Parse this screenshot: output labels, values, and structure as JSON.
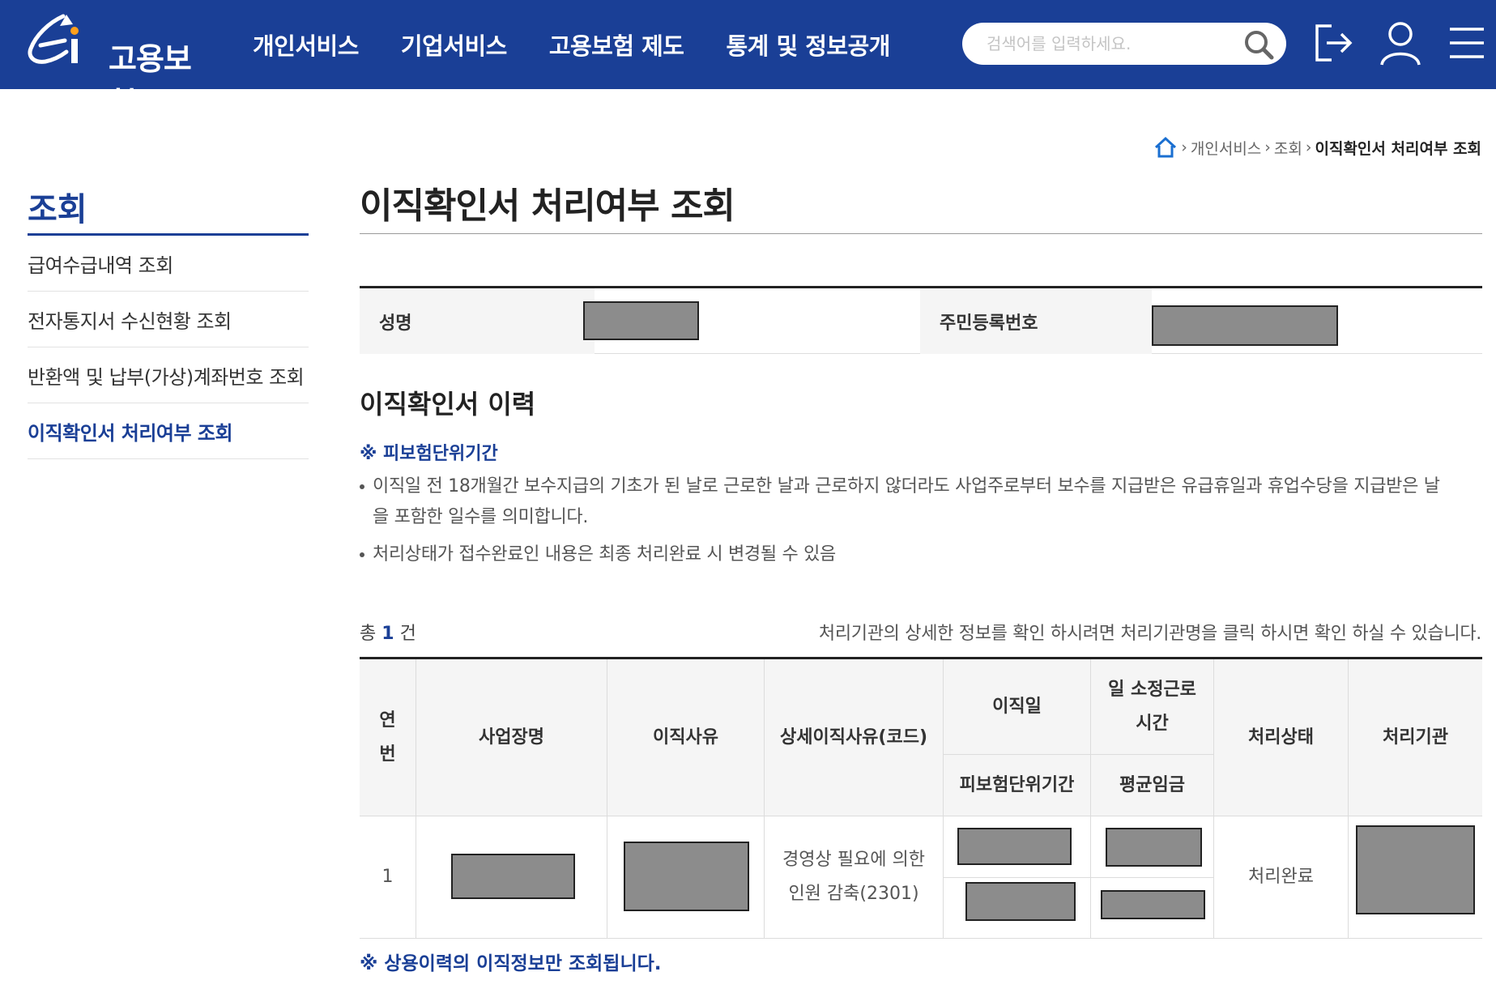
{
  "header": {
    "logo_text": "고용보험",
    "nav": [
      "개인서비스",
      "기업서비스",
      "고용보험 제도",
      "통계 및 정보공개"
    ],
    "search_placeholder": "검색어를 입력하세요.",
    "brand_color": "#1a3f96"
  },
  "breadcrumb": {
    "items": [
      "개인서비스",
      "조회"
    ],
    "current": "이직확인서 처리여부 조회"
  },
  "sidebar": {
    "title": "조회",
    "items": [
      {
        "label": "급여수급내역 조회",
        "active": false
      },
      {
        "label": "전자통지서 수신현황 조회",
        "active": false
      },
      {
        "label": "반환액 및 납부(가상)계좌번호 조회",
        "active": false
      },
      {
        "label": "이직확인서 처리여부 조회",
        "active": true
      }
    ]
  },
  "main": {
    "title": "이직확인서 처리여부 조회",
    "info": {
      "name_label": "성명",
      "rrn_label": "주민등록번호"
    },
    "history_title": "이직확인서 이력",
    "note_title": "※ 피보험단위기간",
    "bullets": [
      "이직일 전 18개월간 보수지급의 기초가 된 날로 근로한 날과 근로하지 않더라도 사업주로부터 보수를 지급받은 유급휴일과 휴업수당을 지급받은 날을 포함한 일수를 의미합니다.",
      "처리상태가 접수완료인 내용은 최종 처리완료 시 변경될 수 있음"
    ],
    "total_prefix": "총",
    "total_count": "1",
    "total_suffix": "건",
    "help_text": "처리기관의 상세한 정보를 확인 하시려면 처리기관명을 클릭 하시면 확인 하실 수 있습니다.",
    "table": {
      "headers": {
        "no": "연번",
        "workplace": "사업장명",
        "reason": "이직사유",
        "detail_reason": "상세이직사유(코드)",
        "leave_date": "이직일",
        "insured_period": "피보험단위기간",
        "daily_hours": "일 소정근로시간",
        "avg_wage": "평균임금",
        "status": "처리상태",
        "agency": "처리기관"
      },
      "rows": [
        {
          "no": "1",
          "detail_reason": "경영상 필요에 의한 인원 감축(2301)",
          "status": "처리완료"
        }
      ]
    },
    "footer_note": "※ 상용이력의 이직정보만 조회됩니다."
  }
}
